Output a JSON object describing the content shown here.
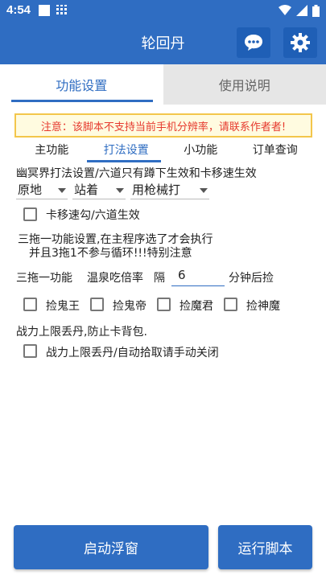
{
  "status": {
    "time": "4:54"
  },
  "app": {
    "title": "轮回丹"
  },
  "tabs": {
    "main": "功能设置",
    "help": "使用说明"
  },
  "notice": "注意：该脚本不支持当前手机分辨率，请联系作者者!",
  "subtabs": [
    "主功能",
    "打法设置",
    "小功能",
    "订单查询"
  ],
  "settings": {
    "desc": "幽冥界打法设置/六道只有蹲下生效和卡移速生效",
    "selects": [
      "原地",
      "站着",
      "用枪械打"
    ],
    "cb_kayi": "卡移速勾/六道生效",
    "tuo_note1": "三拖一功能设置,在主程序选了才会执行",
    "tuo_note2": "并且3拖1不参与循环!!!特别注意",
    "tuo_label": "三拖一功能",
    "wenquan_label": "温泉吃倍率",
    "ge_label": "隔",
    "interval_value": "6",
    "after_label": "分钟后捡",
    "pick": [
      "捡鬼王",
      "捡鬼帝",
      "捡魔君",
      "捡神魔"
    ],
    "limit_note": "战力上限丢丹,防止卡背包.",
    "cb_limit": "战力上限丢丹/自动拾取请手动关闭"
  },
  "buttons": {
    "float": "启动浮窗",
    "run": "运行脚本"
  },
  "colors": {
    "primary": "#2f6dc2",
    "warning_text": "#e63a2e",
    "warning_border": "#f3c64b"
  }
}
